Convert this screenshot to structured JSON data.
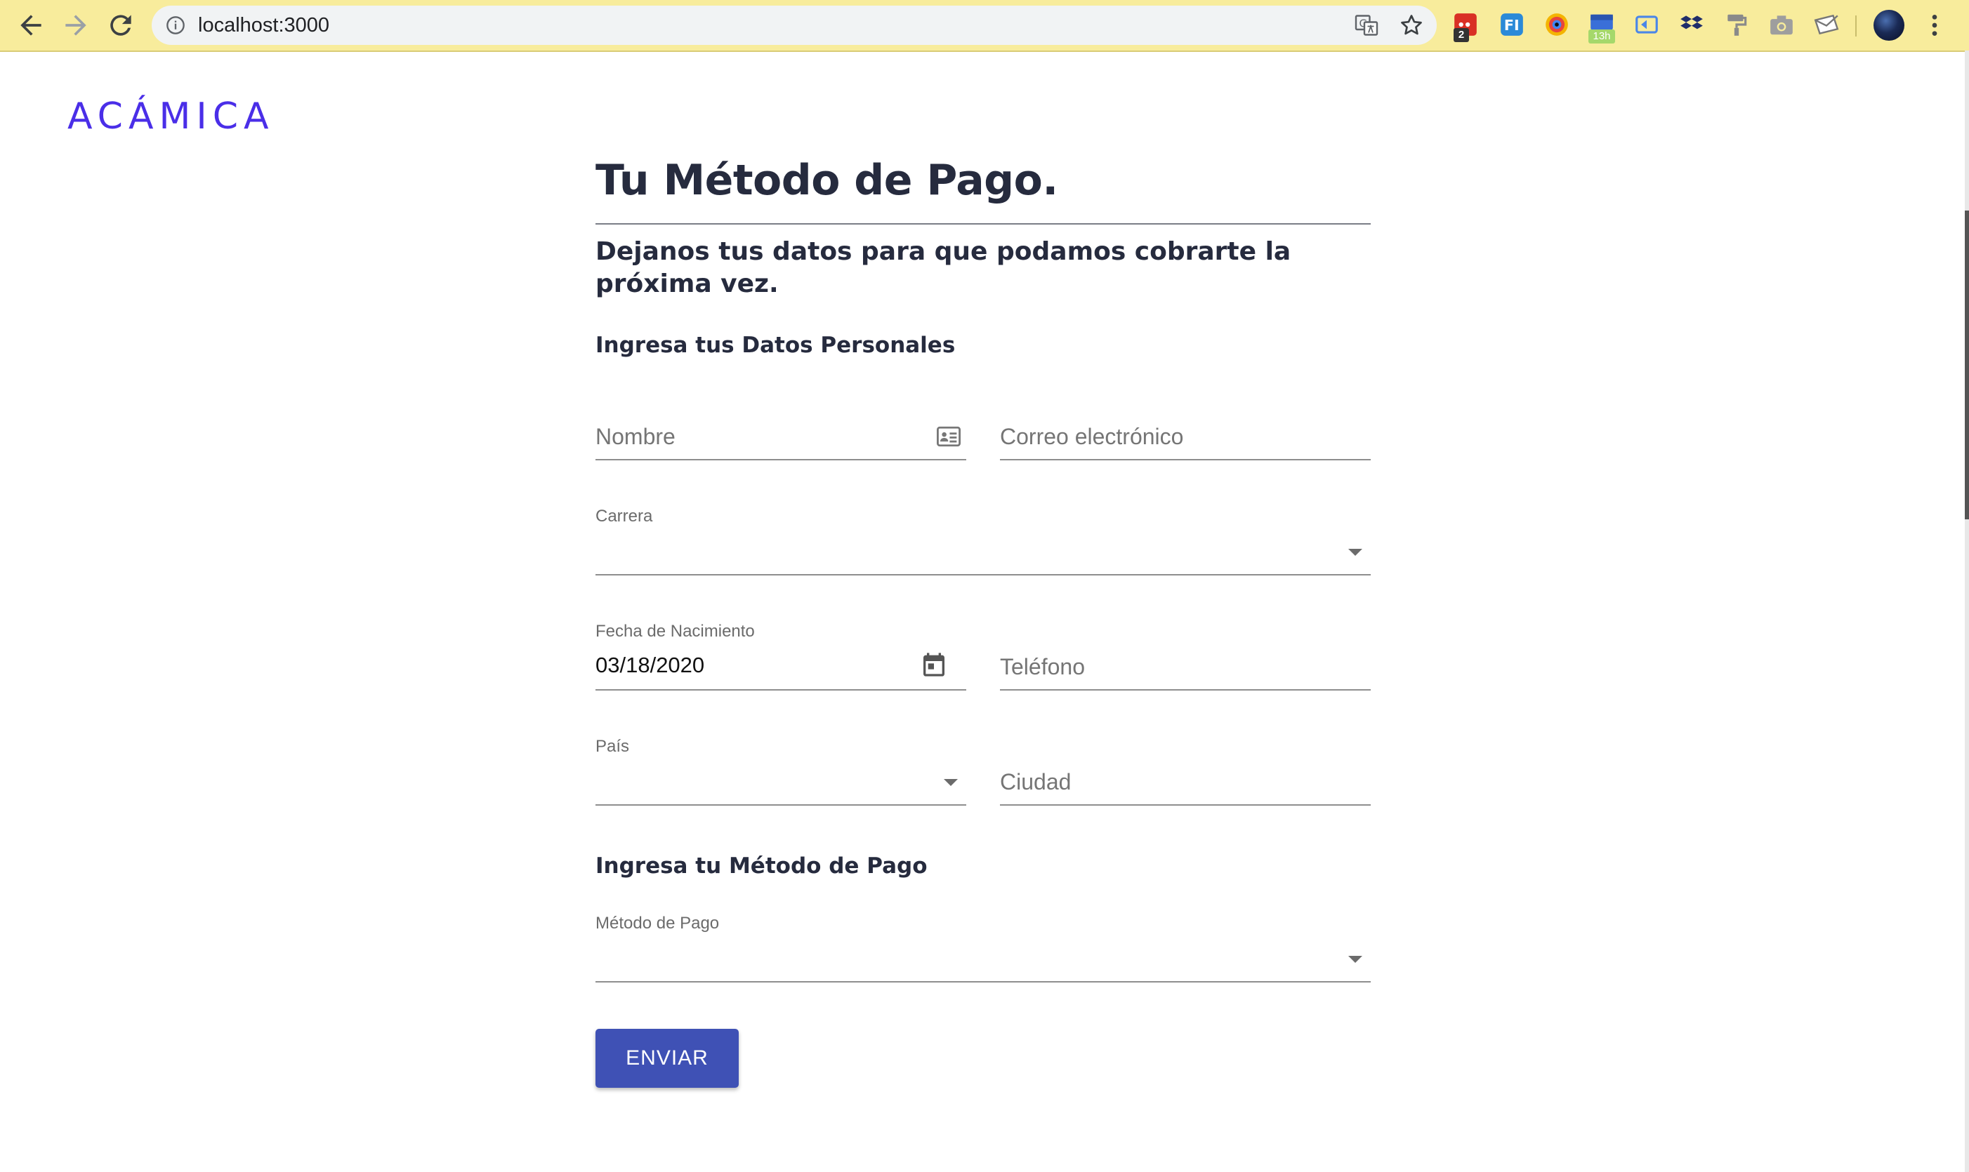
{
  "browser": {
    "url": "localhost:3000",
    "extensions": [
      {
        "icon": "extension-red-counter-icon",
        "badge": "2"
      },
      {
        "icon": "extension-fi-icon"
      },
      {
        "icon": "extension-eye-icon"
      },
      {
        "icon": "extension-calendar-icon",
        "badge": "13h"
      },
      {
        "icon": "extension-cast-icon"
      },
      {
        "icon": "extension-dropbox-icon"
      },
      {
        "icon": "extension-paint-roller-icon"
      },
      {
        "icon": "extension-camera-icon"
      },
      {
        "icon": "extension-envelope-icon"
      }
    ]
  },
  "logo": "ACÁMICA",
  "page": {
    "title": "Tu Método de Pago.",
    "subtitle": "Dejanos tus datos para que podamos cobrarte la próxima vez.",
    "personal_section": "Ingresa tus Datos Personales",
    "payment_section": "Ingresa tu Método de Pago"
  },
  "form": {
    "nombre": {
      "placeholder": "Nombre"
    },
    "correo": {
      "placeholder": "Correo electrónico"
    },
    "carrera": {
      "label": "Carrera",
      "value": ""
    },
    "fecha": {
      "label": "Fecha de Nacimiento",
      "value": "03/18/2020"
    },
    "telefono": {
      "placeholder": "Teléfono"
    },
    "pais": {
      "label": "País",
      "value": ""
    },
    "ciudad": {
      "placeholder": "Ciudad"
    },
    "metodo": {
      "label": "Método de Pago",
      "value": ""
    },
    "submit_label": "ENVIAR"
  },
  "colors": {
    "toolbar": "#f8ec9c",
    "logo": "#4a2ee8",
    "heading": "#262b3e",
    "button": "#3f51b5"
  }
}
